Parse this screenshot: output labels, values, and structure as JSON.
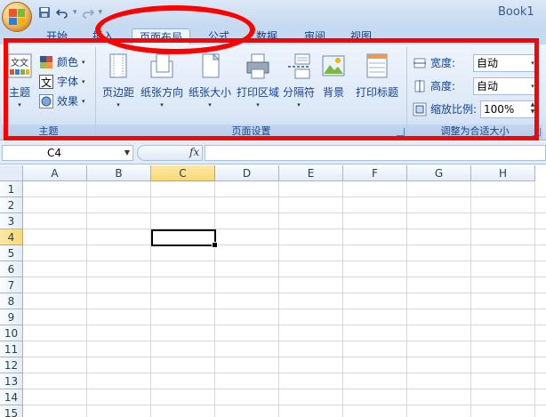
{
  "window": {
    "title": "Book1"
  },
  "quick_access": {
    "save_icon": "save-icon",
    "undo_icon": "undo-icon",
    "redo_icon": "redo-icon"
  },
  "tabs": [
    {
      "label": "开始"
    },
    {
      "label": "插入"
    },
    {
      "label": "页面布局",
      "active": true
    },
    {
      "label": "公式"
    },
    {
      "label": "数据"
    },
    {
      "label": "审阅"
    },
    {
      "label": "视图"
    }
  ],
  "ribbon": {
    "theme_group": {
      "label": "主题",
      "themes_label": "主题",
      "colors_label": "颜色",
      "fonts_label": "字体",
      "effects_label": "效果"
    },
    "page_setup_group": {
      "label": "页面设置",
      "buttons": [
        "页边距",
        "纸张方向",
        "纸张大小",
        "打印区域",
        "分隔符",
        "背景",
        "打印标题"
      ]
    },
    "scale_group": {
      "label": "调整为合适大小",
      "width_label": "宽度:",
      "width_value": "自动",
      "height_label": "高度:",
      "height_value": "自动",
      "scale_label": "缩放比例:",
      "scale_value": "100%"
    }
  },
  "formula_bar": {
    "name_box": "C4",
    "fx": "fx",
    "formula": ""
  },
  "sheet": {
    "columns": [
      "A",
      "B",
      "C",
      "D",
      "E",
      "F",
      "G",
      "H"
    ],
    "rows": [
      "1",
      "2",
      "3",
      "4",
      "5",
      "6",
      "7",
      "8",
      "9",
      "10",
      "11",
      "12",
      "13",
      "14",
      "15"
    ],
    "selected_cell": "C4",
    "selected_column": "C",
    "selected_row": "4"
  },
  "annotations": {
    "color": "#ff0000"
  }
}
